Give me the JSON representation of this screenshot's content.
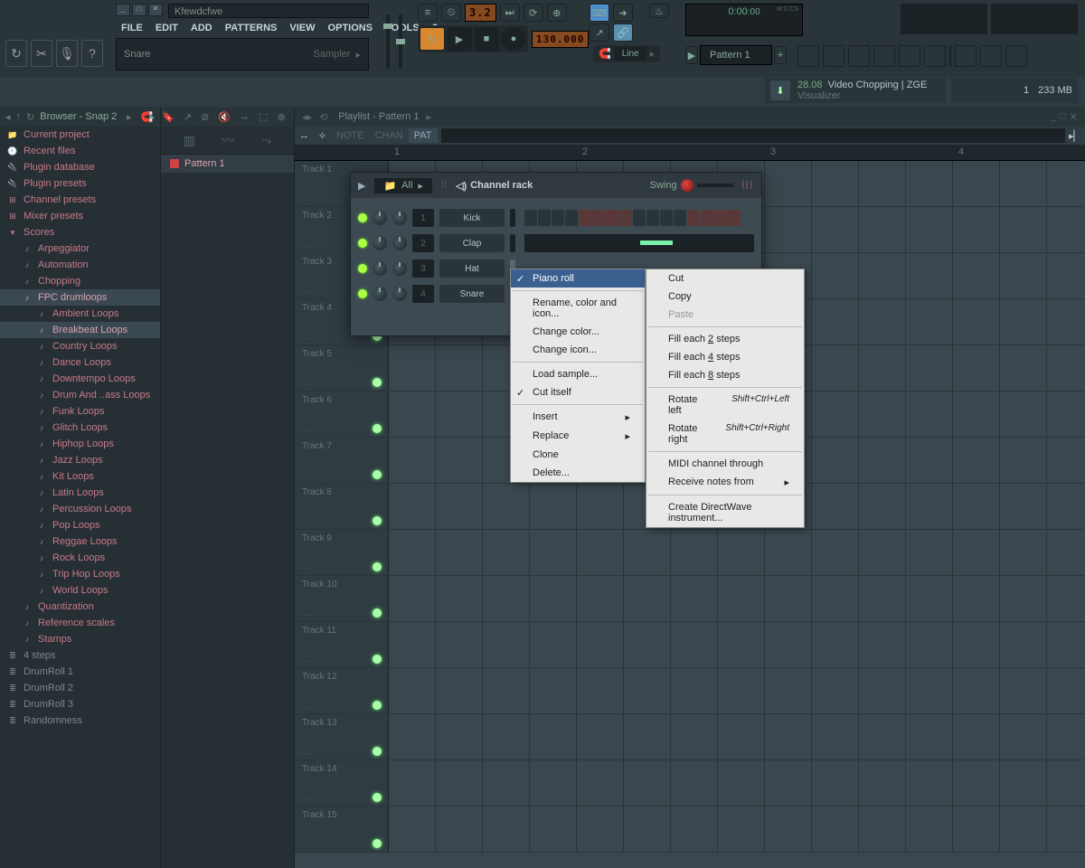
{
  "window": {
    "title": "Kfewdcfwe"
  },
  "menu": [
    "FILE",
    "EDIT",
    "ADD",
    "PATTERNS",
    "VIEW",
    "OPTIONS",
    "TOOLS",
    "?"
  ],
  "hint": {
    "left": "Snare",
    "right": "Sampler"
  },
  "transport": {
    "tempo": "130.000",
    "counter": "3.2",
    "snap": "Line"
  },
  "time": {
    "value": "0:00",
    "cs": ":00",
    "label": "M:S:CS"
  },
  "pattern_selector": "Pattern 1",
  "news": {
    "percent": "28.08",
    "title": "Video Chopping | ZGE",
    "sub": "Visualizer"
  },
  "mem": {
    "count": "1",
    "mb": "233 MB"
  },
  "browser": {
    "title": "Browser - Snap 2",
    "items": [
      {
        "label": "Current project",
        "cls": "cat",
        "icon": "📁"
      },
      {
        "label": "Recent files",
        "cls": "cat",
        "icon": "🕘"
      },
      {
        "label": "Plugin database",
        "cls": "cat",
        "icon": "🔌"
      },
      {
        "label": "Plugin presets",
        "cls": "cat",
        "icon": "🔌"
      },
      {
        "label": "Channel presets",
        "cls": "cat",
        "icon": "⊞"
      },
      {
        "label": "Mixer presets",
        "cls": "cat",
        "icon": "⊞"
      },
      {
        "label": "Scores",
        "cls": "cat",
        "icon": "▾"
      },
      {
        "label": "Arpeggiator",
        "cls": "sub",
        "icon": "♪"
      },
      {
        "label": "Automation",
        "cls": "sub",
        "icon": "♪"
      },
      {
        "label": "Chopping",
        "cls": "sub",
        "icon": "♪"
      },
      {
        "label": "FPC drumloops",
        "cls": "sub sel",
        "icon": "♪"
      },
      {
        "label": "Ambient Loops",
        "cls": "subsub",
        "icon": "♪"
      },
      {
        "label": "Breakbeat Loops",
        "cls": "subsub sel",
        "icon": "♪"
      },
      {
        "label": "Country Loops",
        "cls": "subsub",
        "icon": "♪"
      },
      {
        "label": "Dance Loops",
        "cls": "subsub",
        "icon": "♪"
      },
      {
        "label": "Downtempo Loops",
        "cls": "subsub",
        "icon": "♪"
      },
      {
        "label": "Drum And ..ass Loops",
        "cls": "subsub",
        "icon": "♪"
      },
      {
        "label": "Funk Loops",
        "cls": "subsub",
        "icon": "♪"
      },
      {
        "label": "Glitch Loops",
        "cls": "subsub",
        "icon": "♪"
      },
      {
        "label": "Hiphop Loops",
        "cls": "subsub",
        "icon": "♪"
      },
      {
        "label": "Jazz Loops",
        "cls": "subsub",
        "icon": "♪"
      },
      {
        "label": "Kit Loops",
        "cls": "subsub",
        "icon": "♪"
      },
      {
        "label": "Latin Loops",
        "cls": "subsub",
        "icon": "♪"
      },
      {
        "label": "Percussion Loops",
        "cls": "subsub",
        "icon": "♪"
      },
      {
        "label": "Pop Loops",
        "cls": "subsub",
        "icon": "♪"
      },
      {
        "label": "Reggae Loops",
        "cls": "subsub",
        "icon": "♪"
      },
      {
        "label": "Rock Loops",
        "cls": "subsub",
        "icon": "♪"
      },
      {
        "label": "Trip Hop Loops",
        "cls": "subsub",
        "icon": "♪"
      },
      {
        "label": "World Loops",
        "cls": "subsub",
        "icon": "♪"
      },
      {
        "label": "Quantization",
        "cls": "sub",
        "icon": "♪"
      },
      {
        "label": "Reference scales",
        "cls": "sub",
        "icon": "♪"
      },
      {
        "label": "Stamps",
        "cls": "sub",
        "icon": "♪"
      },
      {
        "label": "4 steps",
        "cls": "cat grey",
        "icon": "≣"
      },
      {
        "label": "DrumRoll 1",
        "cls": "cat grey",
        "icon": "≣"
      },
      {
        "label": "DrumRoll 2",
        "cls": "cat grey",
        "icon": "≣"
      },
      {
        "label": "DrumRoll 3",
        "cls": "cat grey",
        "icon": "≣"
      },
      {
        "label": "Randomness",
        "cls": "cat grey",
        "icon": "≣"
      }
    ]
  },
  "picker": {
    "items": [
      "Pattern 1"
    ]
  },
  "playlist": {
    "title": "Playlist - Pattern 1",
    "tabs": [
      "NOTE",
      "CHAN",
      "PAT"
    ],
    "ruler": [
      "1",
      "2",
      "3",
      "4"
    ],
    "tracks": [
      "Track 1",
      "Track 2",
      "Track 3",
      "Track 4",
      "Track 5",
      "Track 6",
      "Track 7",
      "Track 8",
      "Track 9",
      "Track 10",
      "Track 11",
      "Track 12",
      "Track 13",
      "Track 14",
      "Track 15"
    ]
  },
  "channel_rack": {
    "title": "Channel rack",
    "group": "All",
    "swing_label": "Swing",
    "add": "+",
    "channels": [
      {
        "num": "1",
        "name": "Kick"
      },
      {
        "num": "2",
        "name": "Clap"
      },
      {
        "num": "3",
        "name": "Hat"
      },
      {
        "num": "4",
        "name": "Snare"
      }
    ]
  },
  "context_menu_1": [
    {
      "label": "Piano roll",
      "check": true,
      "hl": true
    },
    {
      "sep": true
    },
    {
      "label": "Rename, color and icon..."
    },
    {
      "label": "Change color..."
    },
    {
      "label": "Change icon..."
    },
    {
      "sep": true
    },
    {
      "label": "Load sample..."
    },
    {
      "label": "Cut itself",
      "check": true
    },
    {
      "sep": true
    },
    {
      "label": "Insert",
      "sub": true
    },
    {
      "label": "Replace",
      "sub": true
    },
    {
      "label": "Clone"
    },
    {
      "label": "Delete..."
    }
  ],
  "context_menu_2": [
    {
      "label": "Cut"
    },
    {
      "label": "Copy"
    },
    {
      "label": "Paste",
      "disabled": true
    },
    {
      "sep": true
    },
    {
      "label": "Fill each 2 steps",
      "ul": "2"
    },
    {
      "label": "Fill each 4 steps",
      "ul": "4"
    },
    {
      "label": "Fill each 8 steps",
      "ul": "8"
    },
    {
      "sep": true
    },
    {
      "label": "Rotate left",
      "shortcut": "Shift+Ctrl+Left"
    },
    {
      "label": "Rotate right",
      "shortcut": "Shift+Ctrl+Right"
    },
    {
      "sep": true
    },
    {
      "label": "MIDI channel through"
    },
    {
      "label": "Receive notes from",
      "sub": true
    },
    {
      "sep": true
    },
    {
      "label": "Create DirectWave instrument..."
    }
  ]
}
